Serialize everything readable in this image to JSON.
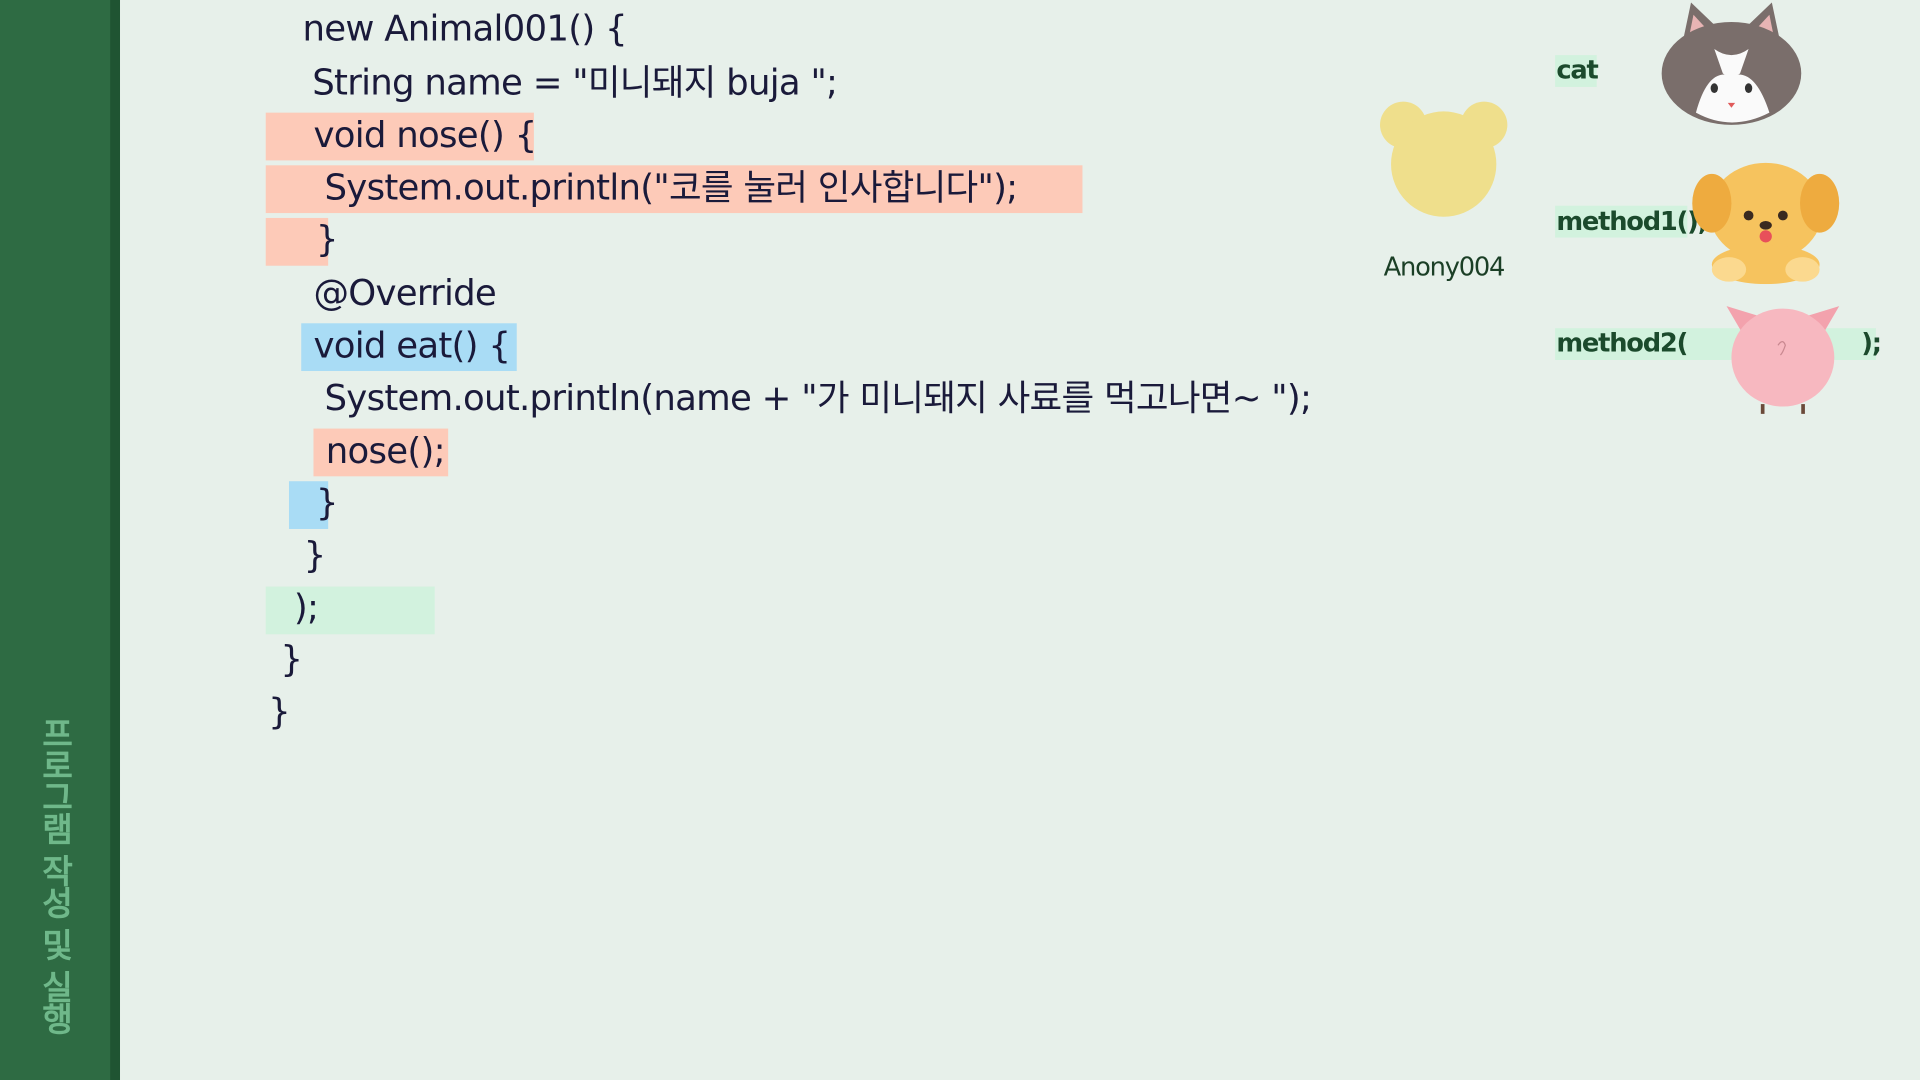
{
  "sidebar": {
    "title": "프로그램 작성 및 실행"
  },
  "code_lines": [
    "new Animal001() {",
    "String name = \"미니돼지 buja \";",
    "void nose() {",
    "System.out.println(\"코를 눌러 인사합니다\");",
    "}",
    "@Override",
    "void eat() {",
    "System.out.println(name + \"가 미니돼지 사료를 먹고나면~ \");",
    "nose();",
    "}",
    "}",
    ");",
    "}",
    "}"
  ],
  "diagram": {
    "anon_label": "Anony004",
    "cat_label": "cat",
    "method1_label": "method1();",
    "method2_open": "method2(",
    "method2_close": ");"
  },
  "colors": {
    "background": "#e7f0ea",
    "sidebar": "#2e6b43",
    "highlight_salmon": "#fdcab8",
    "highlight_blue": "#a9dcf5",
    "highlight_green": "#d2f2de"
  }
}
